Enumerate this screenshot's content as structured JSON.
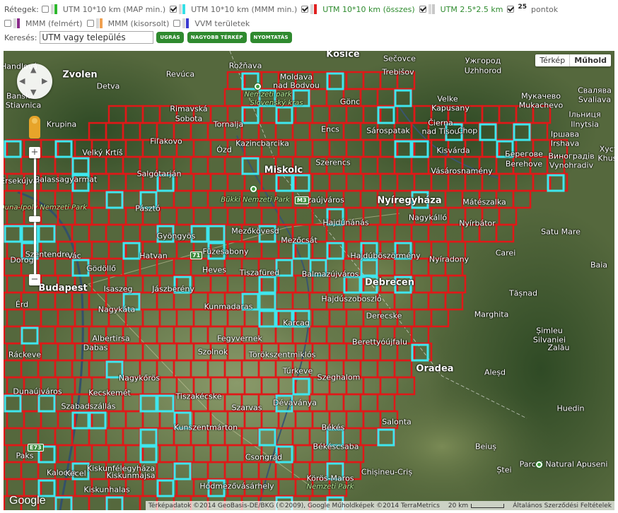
{
  "controls": {
    "layers_label": "Rétegek:",
    "layers": [
      {
        "label": "UTM 10*10 km (MAP min.)",
        "checked": false,
        "color": "#2eb82e",
        "style": "gray"
      },
      {
        "label": "UTM 10*10 km (MMM min.)",
        "checked": true,
        "color": "#35e0e6",
        "style": "gray"
      },
      {
        "label": "UTM 10*10 km (összes)",
        "checked": true,
        "color": "#e02020",
        "style": "green"
      },
      {
        "label": "UTM 2.5*2.5 km",
        "checked": true,
        "color": "#c8c8c8",
        "style": "green"
      },
      {
        "label": "MMM (felmért)",
        "checked": false,
        "color": "#8a2b8a",
        "style": "gray"
      },
      {
        "label": "MMM (kisorsolt)",
        "checked": false,
        "color": "#f0a050",
        "style": "gray"
      },
      {
        "label": "VVM területek",
        "checked": false,
        "color": "#3a3ad0",
        "style": "gray"
      }
    ],
    "points_badge": "25",
    "points_label": "pontok",
    "points_checked": true,
    "search_label": "Keresés:",
    "search_value": "UTM vagy település",
    "buttons": {
      "jump": "UGRÁS",
      "bigger_map": "NAGYOBB TÉRKÉP",
      "print": "NYOMTATÁS"
    }
  },
  "map": {
    "type_map": "Térkép",
    "type_satellite": "Műhold",
    "zoom_in": "+",
    "zoom_out": "−",
    "logo": "Google",
    "attribution": "Térképadatok ©2014 GeoBasis-DE/BKG (©2009), Google Műholdképek ©2014 TerraMetrics",
    "scale": "20 km",
    "terms": "Általános Szerződési Feltételek",
    "road_shields": [
      "M3",
      "71",
      "E73"
    ],
    "places": [
      {
        "name": "Košice",
        "big": true
      },
      {
        "name": "Zvolen",
        "big": true
      },
      {
        "name": "Rožňava"
      },
      {
        "name": "Sečovce"
      },
      {
        "name": "Ужгород"
      },
      {
        "name": "Uzhhorod"
      },
      {
        "name": "Handlová"
      },
      {
        "name": "Revúca"
      },
      {
        "name": "Moldava"
      },
      {
        "name": "nad Bodvou"
      },
      {
        "name": "Trebišov"
      },
      {
        "name": "Banská"
      },
      {
        "name": "Stiavnica"
      },
      {
        "name": "Detva"
      },
      {
        "name": "Nemzeti park"
      },
      {
        "name": "Slovenský kras"
      },
      {
        "name": "Velke"
      },
      {
        "name": "Kapusany"
      },
      {
        "name": "Мукачево"
      },
      {
        "name": "Mukachevo"
      },
      {
        "name": "Свалява"
      },
      {
        "name": "Svaliava"
      },
      {
        "name": "Krupina"
      },
      {
        "name": "Rimavská"
      },
      {
        "name": "Sobota"
      },
      {
        "name": "Tornalja"
      },
      {
        "name": "Encs"
      },
      {
        "name": "Gönc"
      },
      {
        "name": "Sárospatak"
      },
      {
        "name": "Čierna"
      },
      {
        "name": "nad Tisou"
      },
      {
        "name": "Chop"
      },
      {
        "name": "Іршава"
      },
      {
        "name": "Irshava"
      },
      {
        "name": "Iльниця"
      },
      {
        "name": "Ilnytsia"
      },
      {
        "name": "Velký Krtíš"
      },
      {
        "name": "Fiľakovo"
      },
      {
        "name": "Ózd"
      },
      {
        "name": "Kazincbarcika"
      },
      {
        "name": "Szerencs"
      },
      {
        "name": "Kisvárda"
      },
      {
        "name": "Берегове"
      },
      {
        "name": "Berehove"
      },
      {
        "name": "Виноградів"
      },
      {
        "name": "Vynohradiv"
      },
      {
        "name": "Хуст"
      },
      {
        "name": "Khust"
      },
      {
        "name": "Salgótarján"
      },
      {
        "name": "Miskolc",
        "big": true
      },
      {
        "name": "Vásárosnamény"
      },
      {
        "name": "Érsekújvár"
      },
      {
        "name": "Balassagyarmat"
      },
      {
        "name": "Bükki Nemzeti Park"
      },
      {
        "name": "Nyíregyháza",
        "big": true
      },
      {
        "name": "Mátészalka"
      },
      {
        "name": "Duna-Ipoly Nemzeti Park"
      },
      {
        "name": "Pásztó"
      },
      {
        "name": "Tiszaújváros"
      },
      {
        "name": "Hajdúnánás"
      },
      {
        "name": "Nagykálló"
      },
      {
        "name": "Nyírbátor"
      },
      {
        "name": "Satu Mare"
      },
      {
        "name": "Mezőkövesd"
      },
      {
        "name": "Gyöngyös"
      },
      {
        "name": "Szentendre"
      },
      {
        "name": "Vác"
      },
      {
        "name": "Mezőcsát"
      },
      {
        "name": "Hatvan"
      },
      {
        "name": "Füzesabony"
      },
      {
        "name": "Hajdúböszörmény"
      },
      {
        "name": "Nyíradony"
      },
      {
        "name": "Carei"
      },
      {
        "name": "Baia"
      },
      {
        "name": "Dorog"
      },
      {
        "name": "Gödöllő"
      },
      {
        "name": "Heves"
      },
      {
        "name": "Tiszafüred"
      },
      {
        "name": "Balmazújváros"
      },
      {
        "name": "Budapest",
        "big": true
      },
      {
        "name": "Isaszeg"
      },
      {
        "name": "Jászberény"
      },
      {
        "name": "Debrecen",
        "big": true
      },
      {
        "name": "Tășnad"
      },
      {
        "name": "Érd"
      },
      {
        "name": "Nagykáta"
      },
      {
        "name": "Hajdúszoboszló"
      },
      {
        "name": "Marghita"
      },
      {
        "name": "Kunmadaras"
      },
      {
        "name": "Karcag"
      },
      {
        "name": "Derecske"
      },
      {
        "name": "Șimleu"
      },
      {
        "name": "Silvaniei"
      },
      {
        "name": "Zalău"
      },
      {
        "name": "Albertirsa"
      },
      {
        "name": "Fegyvernek"
      },
      {
        "name": "Berettyóújfalu"
      },
      {
        "name": "Aleșd"
      },
      {
        "name": "Szolnok"
      },
      {
        "name": "Törökszentmiklós"
      },
      {
        "name": "Túrkeve"
      },
      {
        "name": "Ráckeve"
      },
      {
        "name": "Dabas"
      },
      {
        "name": "Szeghalom"
      },
      {
        "name": "Oradea",
        "big": true
      },
      {
        "name": "Dunaújváros"
      },
      {
        "name": "Nagykőrös"
      },
      {
        "name": "Kecskemét"
      },
      {
        "name": "Tiszakécske"
      },
      {
        "name": "Szarvas"
      },
      {
        "name": "Dévaványa"
      },
      {
        "name": "Szabadszállás"
      },
      {
        "name": "Huedin"
      },
      {
        "name": "Kunszentmárton"
      },
      {
        "name": "Békés"
      },
      {
        "name": "Salonta"
      },
      {
        "name": "Paks"
      },
      {
        "name": "Kalocsa"
      },
      {
        "name": "Kiskunfélegyháza"
      },
      {
        "name": "Csongrád"
      },
      {
        "name": "Békéscsaba"
      },
      {
        "name": "Beiuș"
      },
      {
        "name": "Chișineu-Criș"
      },
      {
        "name": "Kecel"
      },
      {
        "name": "Kiskunmajsa"
      },
      {
        "name": "Körös-Maros"
      },
      {
        "name": "Nemzeti Park"
      },
      {
        "name": "Ștei"
      },
      {
        "name": "Parcul Natural Apuseni"
      },
      {
        "name": "Kiskunhalas"
      },
      {
        "name": "Hódmezővásárhely"
      }
    ]
  }
}
